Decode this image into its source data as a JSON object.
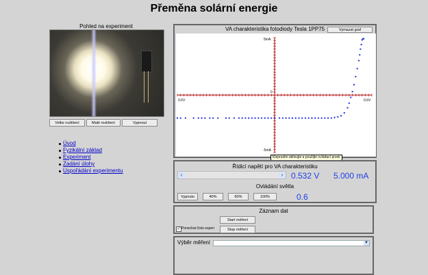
{
  "page": {
    "title": "Přeměna solární energie"
  },
  "camera": {
    "caption": "Pohled na experiment",
    "buttons": [
      "Velke rozlišení",
      "Malé rozlišení",
      "Vypnout"
    ]
  },
  "nav": {
    "items": [
      "Úvod",
      "Fyzikální základ",
      "Experiment",
      "Zadání úlohy",
      "Uspořádání experimentu"
    ]
  },
  "chart": {
    "title": "VA charakteristika fotodiody Tesla 1PP75",
    "export_button": "Vymazat graf",
    "tooltip": "Klepnutím aktivujte a použijte ovládací prvek"
  },
  "chart_data": {
    "type": "scatter",
    "xlabel": "",
    "ylabel": "",
    "xlim": [
      -0.6,
      0.6
    ],
    "ylim": [
      -5,
      5
    ],
    "tick_labels": {
      "x_min": "0.6V",
      "x_max": "0.6V",
      "y_max": "5mA",
      "y_zero": "0",
      "y_min": "-5mA"
    },
    "grid": false,
    "points": [
      {
        "x": -0.6,
        "y": -2.0
      },
      {
        "x": -0.58,
        "y": -2.0
      },
      {
        "x": -0.55,
        "y": -2.0
      },
      {
        "x": -0.5,
        "y": -2.0
      },
      {
        "x": -0.47,
        "y": -2.0
      },
      {
        "x": -0.45,
        "y": -2.0
      },
      {
        "x": -0.43,
        "y": -2.0
      },
      {
        "x": -0.4,
        "y": -2.0
      },
      {
        "x": -0.38,
        "y": -2.0
      },
      {
        "x": -0.35,
        "y": -2.0
      },
      {
        "x": -0.3,
        "y": -2.0
      },
      {
        "x": -0.28,
        "y": -2.0
      },
      {
        "x": -0.25,
        "y": -2.0
      },
      {
        "x": -0.22,
        "y": -2.0
      },
      {
        "x": -0.2,
        "y": -2.0
      },
      {
        "x": -0.18,
        "y": -2.0
      },
      {
        "x": -0.16,
        "y": -2.0
      },
      {
        "x": -0.14,
        "y": -2.0
      },
      {
        "x": -0.12,
        "y": -2.0
      },
      {
        "x": -0.1,
        "y": -2.0
      },
      {
        "x": -0.08,
        "y": -2.0
      },
      {
        "x": -0.06,
        "y": -2.0
      },
      {
        "x": -0.04,
        "y": -2.0
      },
      {
        "x": -0.02,
        "y": -2.0
      },
      {
        "x": 0.0,
        "y": -2.0
      },
      {
        "x": 0.03,
        "y": -2.0
      },
      {
        "x": 0.05,
        "y": -2.0
      },
      {
        "x": 0.07,
        "y": -2.0
      },
      {
        "x": 0.09,
        "y": -2.0
      },
      {
        "x": 0.11,
        "y": -2.0
      },
      {
        "x": 0.13,
        "y": -2.0
      },
      {
        "x": 0.15,
        "y": -2.0
      },
      {
        "x": 0.17,
        "y": -2.0
      },
      {
        "x": 0.19,
        "y": -2.0
      },
      {
        "x": 0.21,
        "y": -2.0
      },
      {
        "x": 0.23,
        "y": -2.0
      },
      {
        "x": 0.25,
        "y": -2.0
      },
      {
        "x": 0.27,
        "y": -2.0
      },
      {
        "x": 0.29,
        "y": -2.0
      },
      {
        "x": 0.31,
        "y": -2.0
      },
      {
        "x": 0.33,
        "y": -2.0
      },
      {
        "x": 0.35,
        "y": -2.0
      },
      {
        "x": 0.37,
        "y": -1.95
      },
      {
        "x": 0.39,
        "y": -1.9
      },
      {
        "x": 0.41,
        "y": -1.8
      },
      {
        "x": 0.43,
        "y": -1.55
      },
      {
        "x": 0.45,
        "y": -1.1
      },
      {
        "x": 0.46,
        "y": -0.7
      },
      {
        "x": 0.47,
        "y": -0.2
      },
      {
        "x": 0.48,
        "y": 0.3
      },
      {
        "x": 0.49,
        "y": 0.9
      },
      {
        "x": 0.5,
        "y": 1.6
      },
      {
        "x": 0.51,
        "y": 2.3
      },
      {
        "x": 0.52,
        "y": 3.0
      },
      {
        "x": 0.525,
        "y": 3.5
      },
      {
        "x": 0.53,
        "y": 4.0
      },
      {
        "x": 0.535,
        "y": 4.4
      },
      {
        "x": 0.54,
        "y": 4.8
      },
      {
        "x": 0.545,
        "y": 4.9
      },
      {
        "x": 0.55,
        "y": 4.9
      }
    ]
  },
  "control": {
    "title": "Řídicí napětí pro VA charakteristiku",
    "voltage": "0.532 V",
    "current": "5.000 mA",
    "light_title": "Ovládání světla",
    "light_buttons": [
      "Vypnuto",
      "40%",
      "60%",
      "100%"
    ],
    "light_value": "0.6"
  },
  "record": {
    "title": "Záznam dat",
    "start": "Start měření",
    "stop": "Stop měření",
    "checkbox_label": "Ponechat číslo experi"
  },
  "select": {
    "label": "Výběr měření",
    "value": ""
  }
}
